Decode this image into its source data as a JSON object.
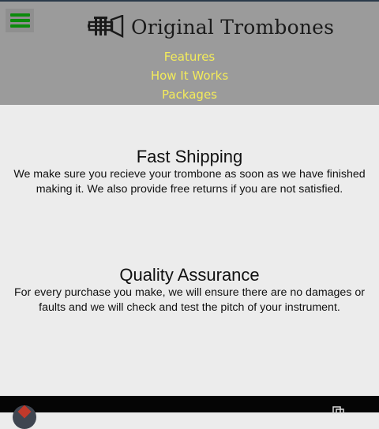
{
  "header": {
    "brand": "Original Trombones",
    "nav": [
      {
        "label": "Features"
      },
      {
        "label": "How It Works"
      },
      {
        "label": "Packages"
      }
    ]
  },
  "sections": [
    {
      "title": "Fast Shipping",
      "body": "We make sure you recieve your trombone as soon as we have finished making it. We also provide free returns if you are not satisfied."
    },
    {
      "title": "Quality Assurance",
      "body": "For every purchase you make, we will ensure there are no damages or faults and we will check and test the pitch of your instrument."
    }
  ],
  "colors": {
    "header_bg": "#9b9b9b",
    "nav_link": "#f4ec5a",
    "menu_icon": "#0c8a0c",
    "page_bg": "#ececec"
  },
  "icons": {
    "menu": "hamburger-icon",
    "logo": "trumpet-logo-icon",
    "copy": "copy-icon"
  }
}
